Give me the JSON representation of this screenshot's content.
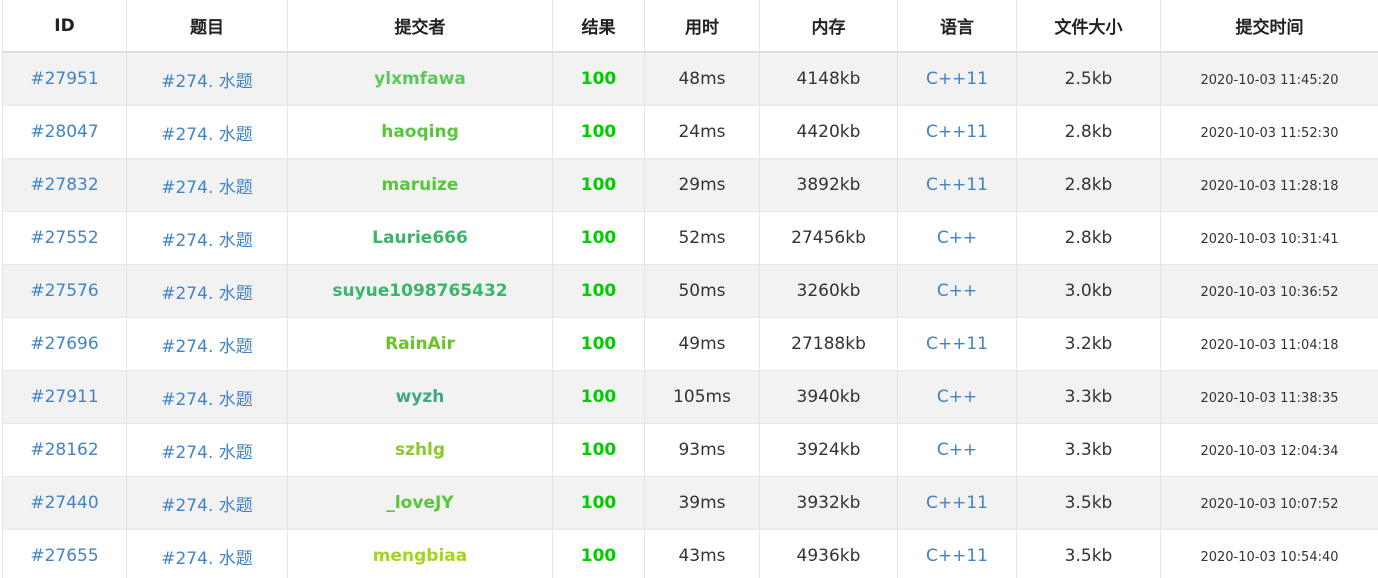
{
  "header": {
    "id": "ID",
    "problem": "题目",
    "submitter": "提交者",
    "result": "结果",
    "time": "用时",
    "memory": "内存",
    "language": "语言",
    "code_size": "文件大小",
    "submit_time": "提交时间"
  },
  "rows": [
    {
      "id": "#27951",
      "problem": "#274. 水题",
      "user": "ylxmfawa",
      "user_color": "#5bc85b",
      "result": "100",
      "result_color": "#00cc00",
      "time": "48ms",
      "memory": "4148kb",
      "language": "C++11",
      "code_size": "2.5kb",
      "submit_time": "2020-10-03 11:45:20"
    },
    {
      "id": "#28047",
      "problem": "#274. 水题",
      "user": "haoqing",
      "user_color": "#56c63a",
      "result": "100",
      "result_color": "#00cc00",
      "time": "24ms",
      "memory": "4420kb",
      "language": "C++11",
      "code_size": "2.8kb",
      "submit_time": "2020-10-03 11:52:30"
    },
    {
      "id": "#27832",
      "problem": "#274. 水题",
      "user": "maruize",
      "user_color": "#56c63a",
      "result": "100",
      "result_color": "#00cc00",
      "time": "29ms",
      "memory": "3892kb",
      "language": "C++11",
      "code_size": "2.8kb",
      "submit_time": "2020-10-03 11:28:18"
    },
    {
      "id": "#27552",
      "problem": "#274. 水题",
      "user": "Laurie666",
      "user_color": "#3bb56a",
      "result": "100",
      "result_color": "#00cc00",
      "time": "52ms",
      "memory": "27456kb",
      "language": "C++",
      "code_size": "2.8kb",
      "submit_time": "2020-10-03 10:31:41"
    },
    {
      "id": "#27576",
      "problem": "#274. 水题",
      "user": "suyue1098765432",
      "user_color": "#3bb56a",
      "result": "100",
      "result_color": "#00cc00",
      "time": "50ms",
      "memory": "3260kb",
      "language": "C++",
      "code_size": "3.0kb",
      "submit_time": "2020-10-03 10:36:52"
    },
    {
      "id": "#27696",
      "problem": "#274. 水题",
      "user": "RainAir",
      "user_color": "#6ac32a",
      "result": "100",
      "result_color": "#00cc00",
      "time": "49ms",
      "memory": "27188kb",
      "language": "C++11",
      "code_size": "3.2kb",
      "submit_time": "2020-10-03 11:04:18"
    },
    {
      "id": "#27911",
      "problem": "#274. 水题",
      "user": "wyzh",
      "user_color": "#3faa7f",
      "result": "100",
      "result_color": "#00cc00",
      "time": "105ms",
      "memory": "3940kb",
      "language": "C++",
      "code_size": "3.3kb",
      "submit_time": "2020-10-03 11:38:35"
    },
    {
      "id": "#28162",
      "problem": "#274. 水题",
      "user": "szhlg",
      "user_color": "#8ac92e",
      "result": "100",
      "result_color": "#00cc00",
      "time": "93ms",
      "memory": "3924kb",
      "language": "C++",
      "code_size": "3.3kb",
      "submit_time": "2020-10-03 12:04:34"
    },
    {
      "id": "#27440",
      "problem": "#274. 水题",
      "user": "_loveJY",
      "user_color": "#56c63a",
      "result": "100",
      "result_color": "#00cc00",
      "time": "39ms",
      "memory": "3932kb",
      "language": "C++11",
      "code_size": "3.5kb",
      "submit_time": "2020-10-03 10:07:52"
    },
    {
      "id": "#27655",
      "problem": "#274. 水题",
      "user": "mengbiaa",
      "user_color": "#a6d41e",
      "result": "100",
      "result_color": "#00cc00",
      "time": "43ms",
      "memory": "4936kb",
      "language": "C++11",
      "code_size": "3.5kb",
      "submit_time": "2020-10-03 10:54:40"
    }
  ],
  "colors": {
    "link": "#4183c4",
    "stripe": "#f2f2f2",
    "accepted": "#00cc00"
  }
}
